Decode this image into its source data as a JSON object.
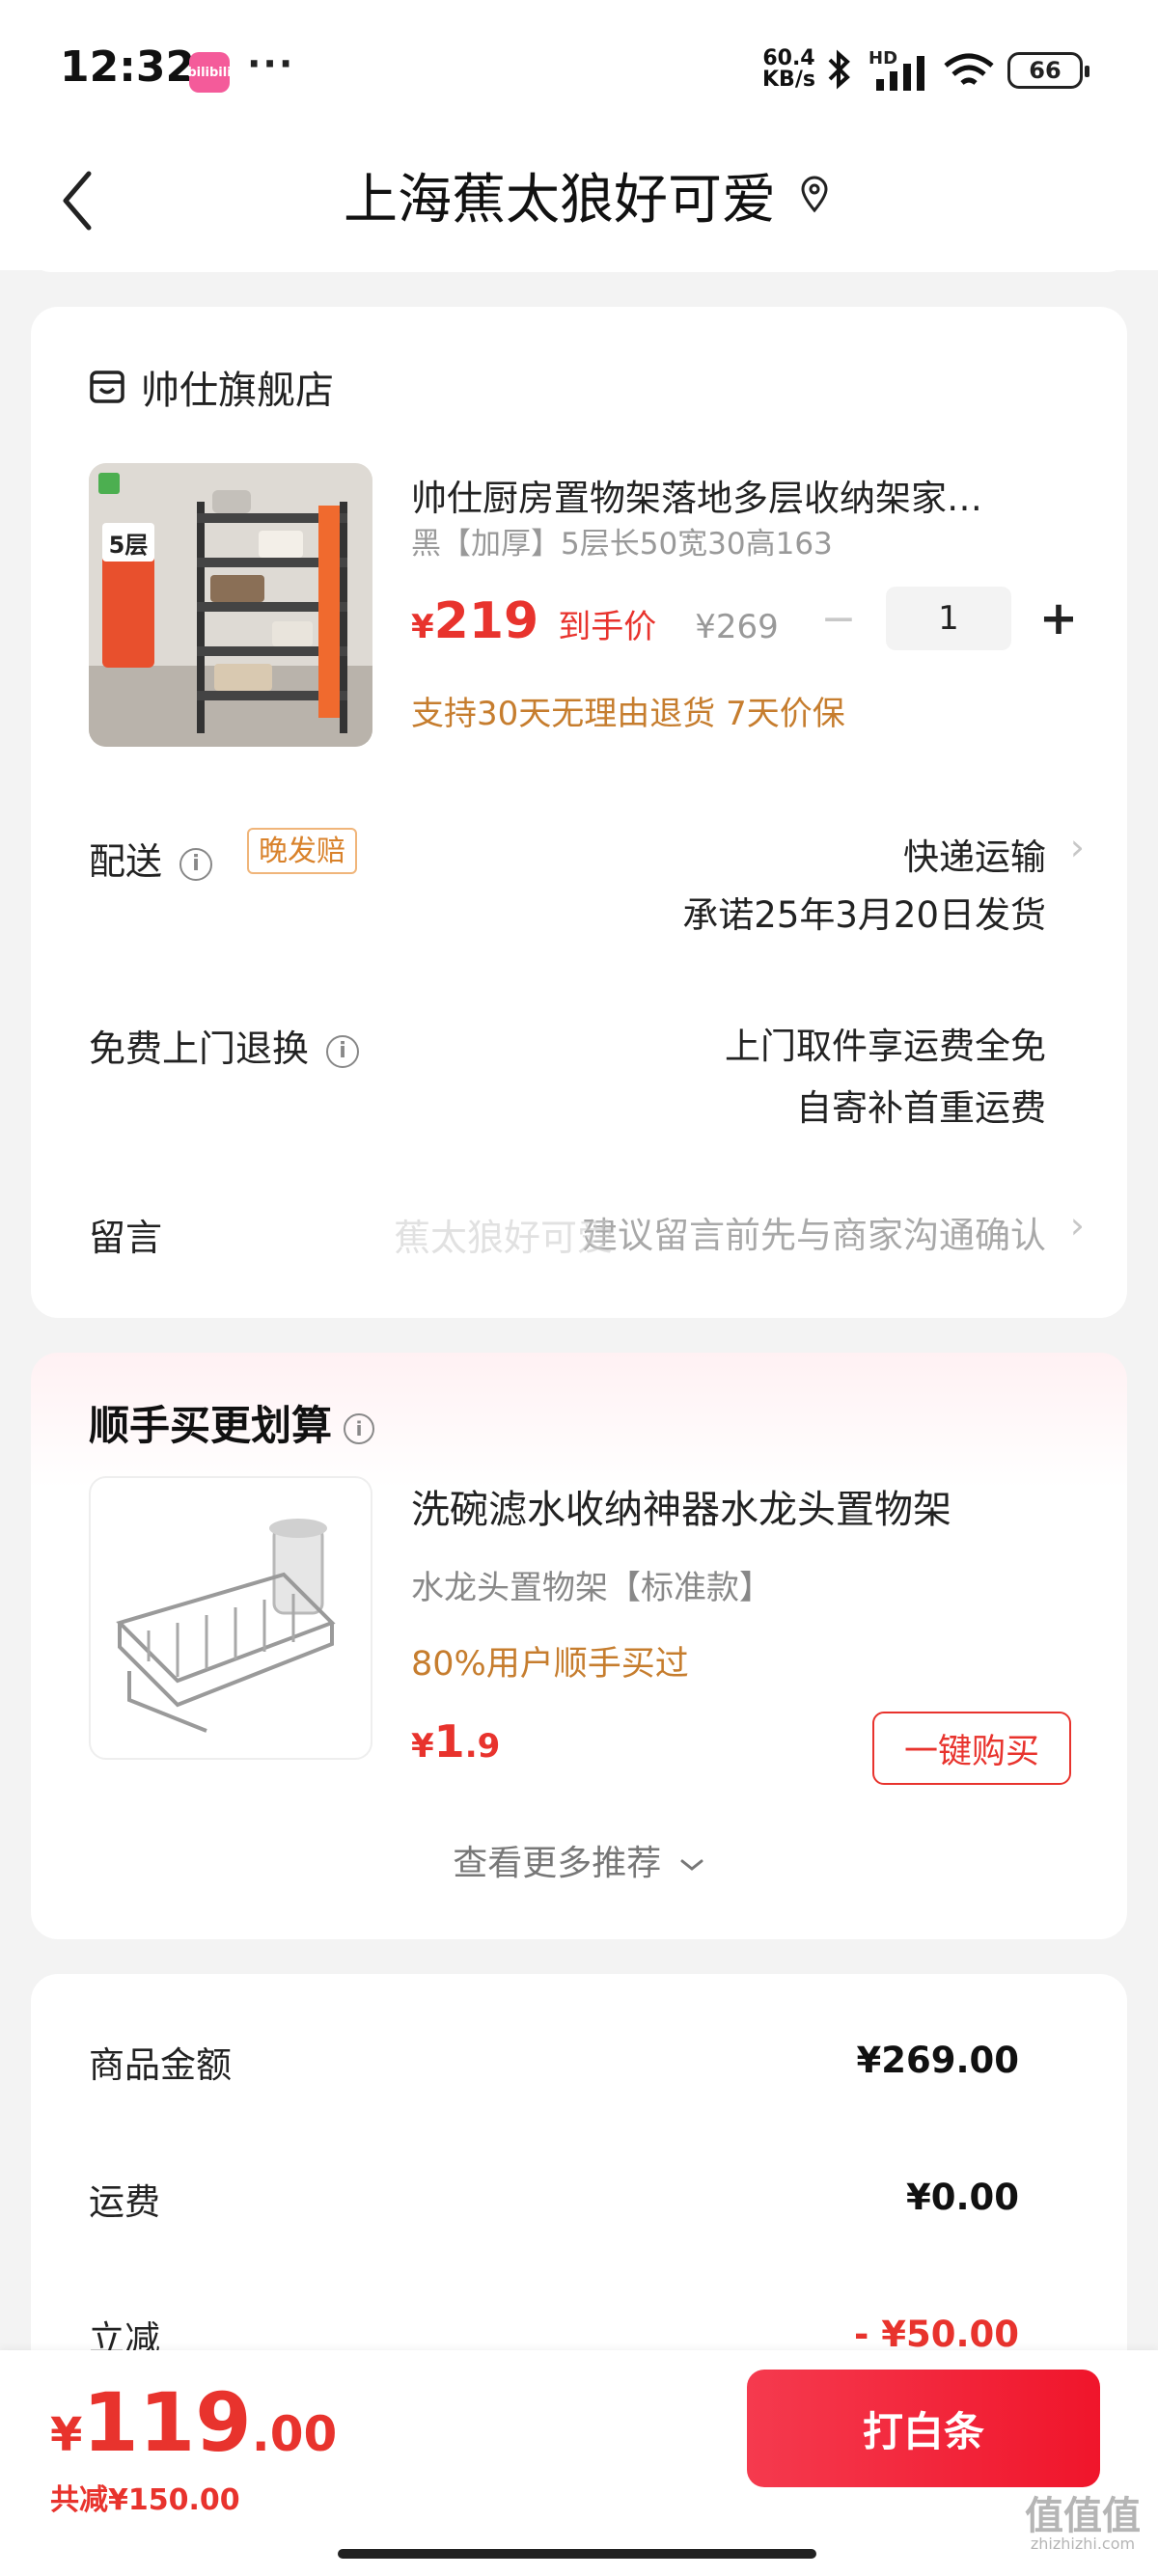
{
  "status_bar": {
    "time": "12:32",
    "app_badge": "bilibili",
    "overflow": "···",
    "net_speed_value": "60.4",
    "net_speed_unit": "KB/s",
    "signal_hd": "HD",
    "battery": "66"
  },
  "nav": {
    "title": "上海蕉太狼好可爱"
  },
  "order": {
    "shop_name": "帅仕旗舰店",
    "product": {
      "title": "帅仕厨房置物架落地多层收纳架家…",
      "spec": "黑【加厚】5层长50宽30高163",
      "price_currency": "¥",
      "price": "219",
      "price_tag": "到手价",
      "original_price": "¥269",
      "quantity": "1",
      "guarantee": "支持30天无理由退货 7天价保",
      "image_badge": "5层"
    },
    "delivery": {
      "label": "配送",
      "badge": "晚发赔",
      "method": "快递运输",
      "promise": "承诺25年3月20日发货"
    },
    "free_return": {
      "label": "免费上门退换",
      "line1": "上门取件享运费全免",
      "line2": "自寄补首重运费"
    },
    "message": {
      "label": "留言",
      "placeholder": "建议留言前先与商家沟通确认",
      "watermark": "蕉太狼好可爱"
    }
  },
  "recommend": {
    "title": "顺手买更划算",
    "item": {
      "name": "洗碗滤水收纳神器水龙头置物架",
      "spec": "水龙头置物架【标准款】",
      "buyers": "80%用户顺手买过",
      "price_currency": "¥",
      "price_int": "1",
      "price_dec": ".9",
      "buy_label": "一键购买"
    },
    "more_label": "查看更多推荐"
  },
  "summary": {
    "goods_label": "商品金额",
    "goods_value": "¥269.00",
    "shipping_label": "运费",
    "shipping_value": "¥0.00",
    "discount_label": "立减",
    "discount_value": "- ¥50.00"
  },
  "footer": {
    "total_currency": "¥",
    "total_int": "119",
    "total_dec": ".00",
    "saved": "共减¥150.00",
    "pay_label": "打白条"
  },
  "site_watermark": {
    "logo": "值值值",
    "url": "zhizhizhi.com"
  },
  "colors": {
    "accent_red": "#e8332d",
    "promo_orange": "#c67d2e",
    "pay_button": "#f0152b",
    "background": "#f3f3f3"
  },
  "icons": [
    "bilibili-app-icon",
    "bluetooth-icon",
    "signal-icon",
    "wifi-icon",
    "battery-icon",
    "back-arrow-icon",
    "location-pin-icon",
    "store-icon",
    "info-icon",
    "chevron-right-icon",
    "chevron-down-icon"
  ]
}
